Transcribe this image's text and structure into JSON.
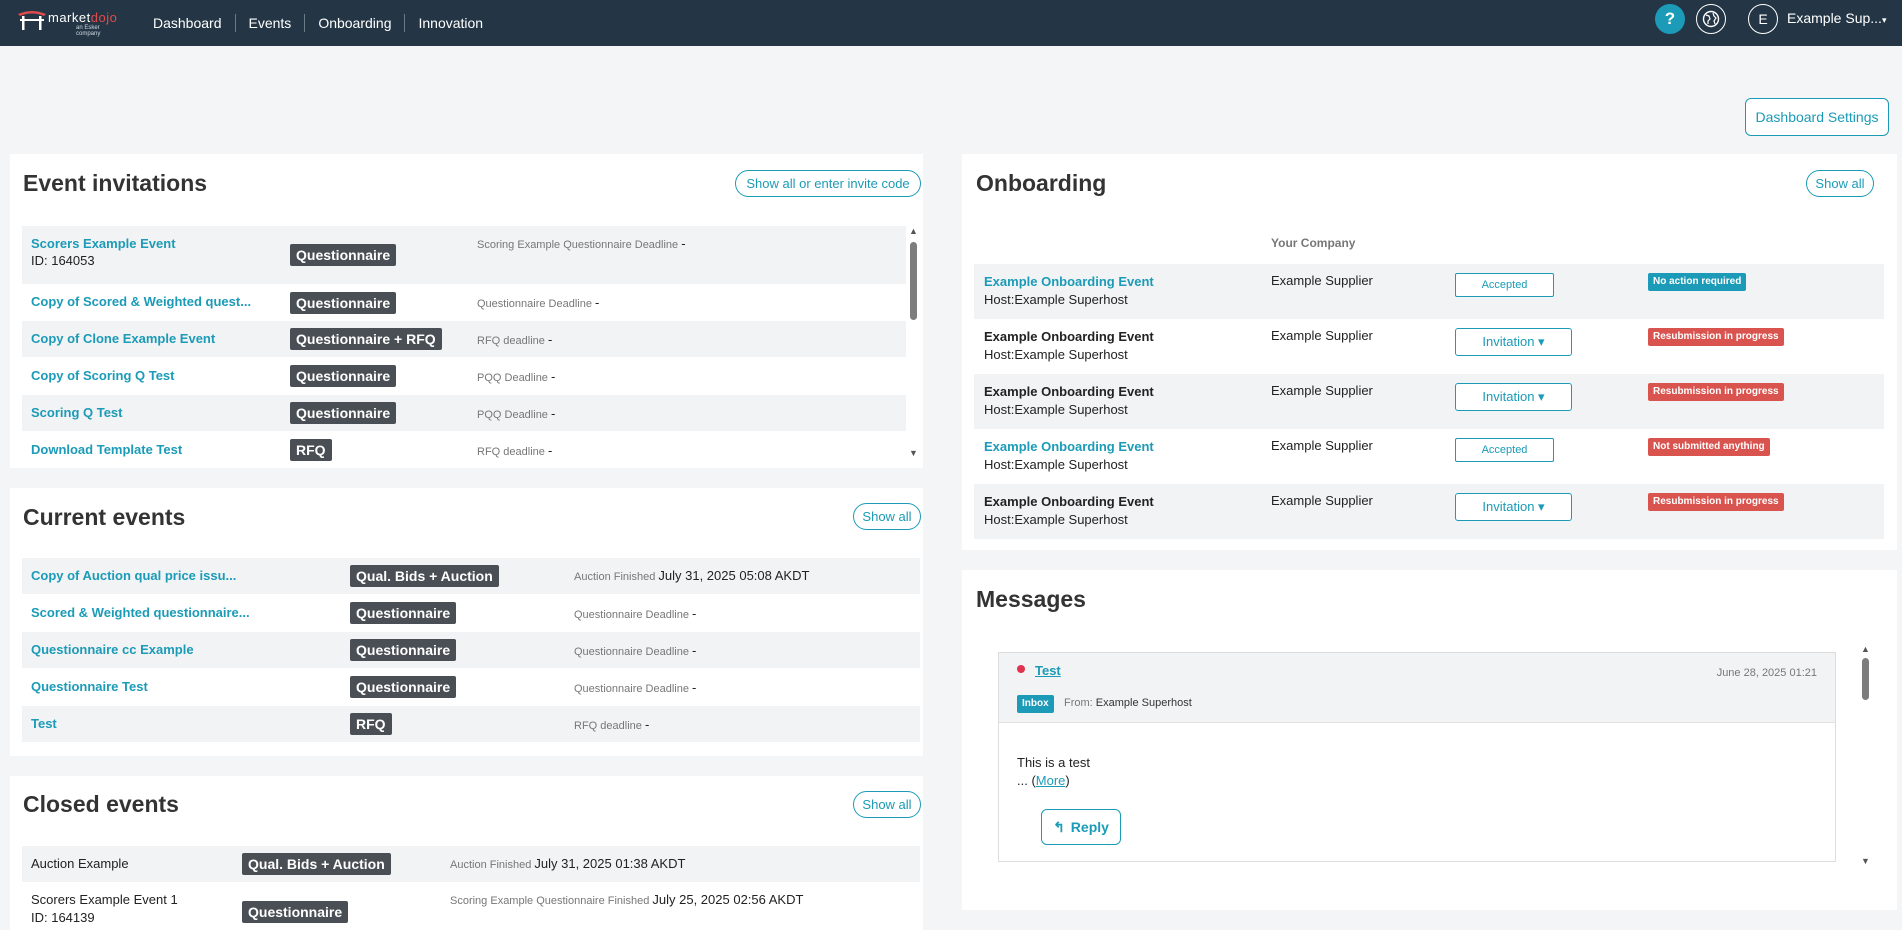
{
  "header": {
    "logo_main": "market",
    "logo_accent": "dojo",
    "logo_sub": "an Esker company",
    "nav": [
      "Dashboard",
      "Events",
      "Onboarding",
      "Innovation"
    ],
    "help": "?",
    "avatar_initial": "E",
    "user_name": "Example Sup..."
  },
  "dashboard_settings": "Dashboard Settings",
  "invitations": {
    "title": "Event invitations",
    "button": "Show all or enter invite code",
    "rows": [
      {
        "name": "Scorers Example Event",
        "id": "ID: 164053",
        "badge": "Questionnaire",
        "deadline_label": "Scoring Example Questionnaire Deadline",
        "deadline_value": "-"
      },
      {
        "name": "Copy of Scored & Weighted quest...",
        "badge": "Questionnaire",
        "deadline_label": "Questionnaire Deadline",
        "deadline_value": "-"
      },
      {
        "name": "Copy of Clone Example Event",
        "badge": "Questionnaire + RFQ",
        "deadline_label": "RFQ deadline",
        "deadline_value": "-"
      },
      {
        "name": "Copy of Scoring Q Test",
        "badge": "Questionnaire",
        "deadline_label": "PQQ Deadline",
        "deadline_value": "-"
      },
      {
        "name": "Scoring Q Test",
        "badge": "Questionnaire",
        "deadline_label": "PQQ Deadline",
        "deadline_value": "-"
      },
      {
        "name": "Download Template Test",
        "badge": "RFQ",
        "deadline_label": "RFQ deadline",
        "deadline_value": "-"
      }
    ]
  },
  "current": {
    "title": "Current events",
    "button": "Show all",
    "rows": [
      {
        "name": "Copy of Auction qual price issu...",
        "badge": "Qual. Bids + Auction",
        "deadline_label": "Auction Finished",
        "deadline_value": "July 31, 2025 05:08 AKDT"
      },
      {
        "name": "Scored & Weighted questionnaire...",
        "badge": "Questionnaire",
        "deadline_label": "Questionnaire Deadline",
        "deadline_value": "-"
      },
      {
        "name": "Questionnaire cc Example",
        "badge": "Questionnaire",
        "deadline_label": "Questionnaire Deadline",
        "deadline_value": "-"
      },
      {
        "name": "Questionnaire Test",
        "badge": "Questionnaire",
        "deadline_label": "Questionnaire Deadline",
        "deadline_value": "-"
      },
      {
        "name": "Test",
        "badge": "RFQ",
        "deadline_label": "RFQ deadline",
        "deadline_value": "-"
      }
    ]
  },
  "closed": {
    "title": "Closed events",
    "button": "Show all",
    "rows": [
      {
        "name": "Auction Example",
        "badge": "Qual. Bids + Auction",
        "deadline_label": "Auction Finished",
        "deadline_value": "July 31, 2025 01:38 AKDT"
      },
      {
        "name": "Scorers Example Event 1",
        "id": "ID: 164139",
        "badge": "Questionnaire",
        "deadline_label": "Scoring Example Questionnaire Finished",
        "deadline_value": "July 25, 2025 02:56 AKDT"
      }
    ]
  },
  "onboarding": {
    "title": "Onboarding",
    "button": "Show all",
    "column_company": "Your Company",
    "rows": [
      {
        "name": "Example Onboarding Event",
        "host": "Host:Example Superhost",
        "company": "Example Supplier",
        "action": "Accepted",
        "status": "No action required",
        "link": true
      },
      {
        "name": "Example Onboarding Event",
        "host": "Host:Example Superhost",
        "company": "Example Supplier",
        "action": "Invitation ▾",
        "status": "Resubmission in progress",
        "link": false
      },
      {
        "name": "Example Onboarding Event",
        "host": "Host:Example Superhost",
        "company": "Example Supplier",
        "action": "Invitation ▾",
        "status": "Resubmission in progress",
        "link": false
      },
      {
        "name": "Example Onboarding Event",
        "host": "Host:Example Superhost",
        "company": "Example Supplier",
        "action": "Accepted",
        "status": "Not submitted anything",
        "link": true
      },
      {
        "name": "Example Onboarding Event",
        "host": "Host:Example Superhost",
        "company": "Example Supplier",
        "action": "Invitation ▾",
        "status": "Resubmission in progress",
        "link": false
      }
    ]
  },
  "messages": {
    "title": "Messages",
    "subject": "Test",
    "date": "June 28, 2025 01:21",
    "folder": "Inbox",
    "from_label": "From:",
    "from": "Example Superhost",
    "body": "This is a test",
    "more_prefix": "... (",
    "more": "More",
    "more_suffix": ")",
    "reply": "Reply"
  },
  "colors": {
    "topbar": "#243645",
    "accent": "#1b9bb7",
    "badge": "#4a4f55",
    "status_red": "#d9544f"
  }
}
